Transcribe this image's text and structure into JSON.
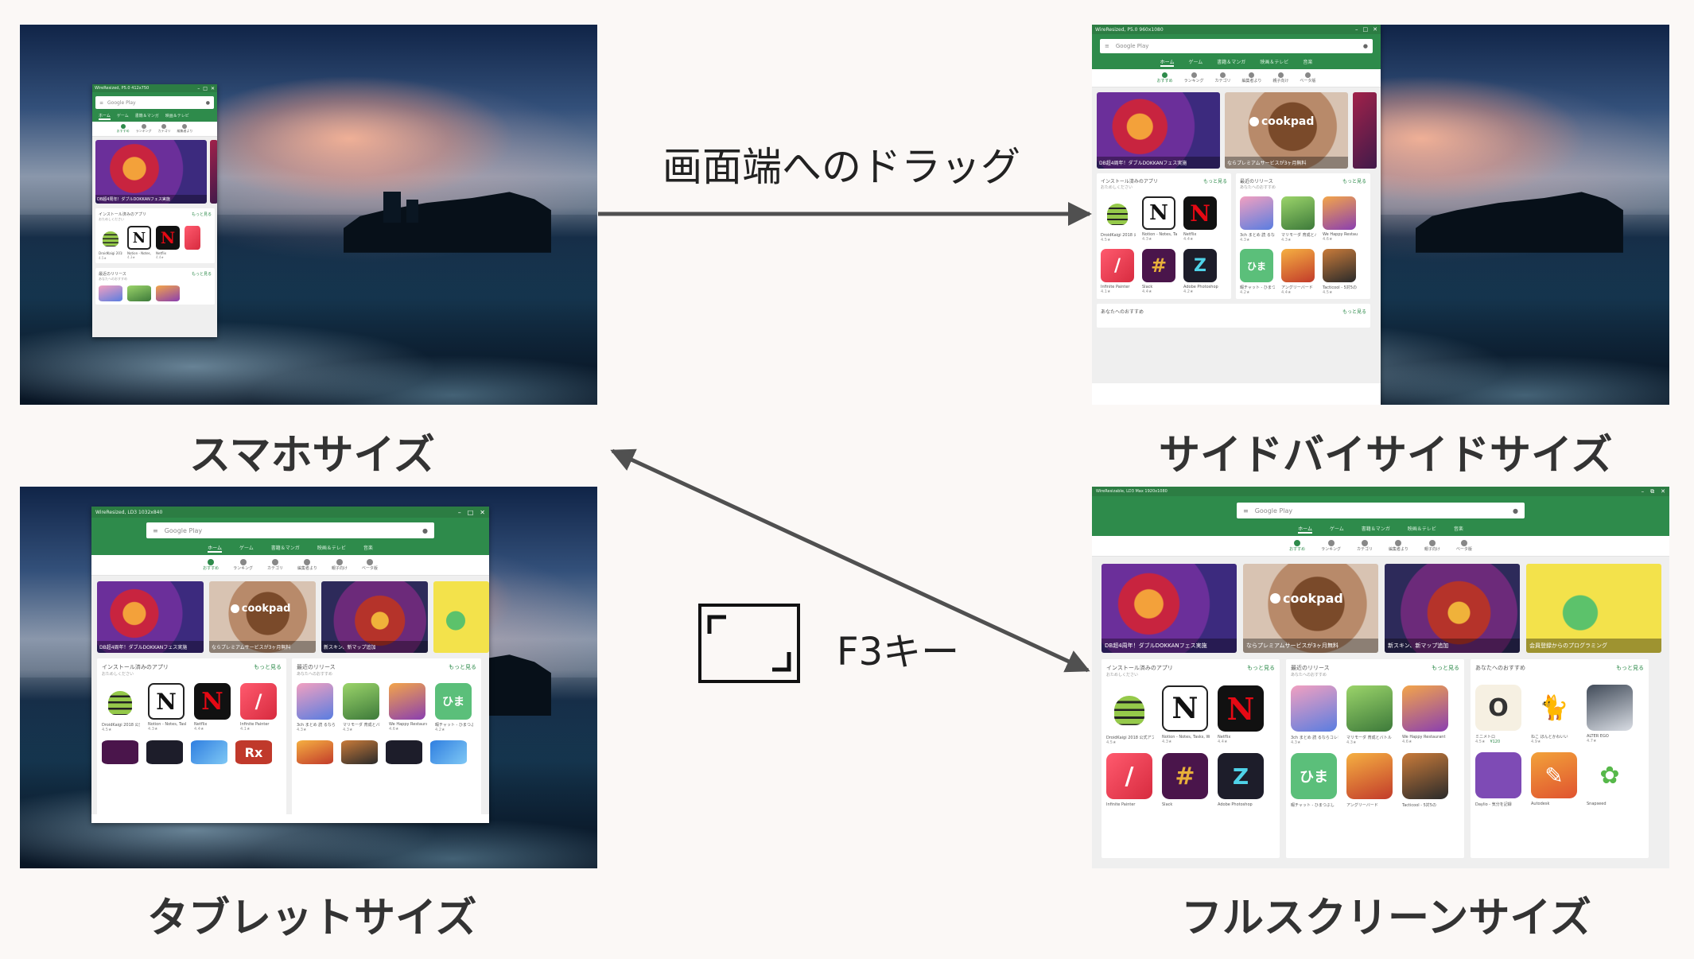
{
  "labels": {
    "phone": "スマホサイズ",
    "sidebyside": "サイドバイサイドサイズ",
    "tablet": "タブレットサイズ",
    "fullscreen": "フルスクリーンサイズ"
  },
  "arrows": {
    "drag_label": "画面端へのドラッグ",
    "key_label": "F3キー"
  },
  "windows": {
    "phone_title": "WireResized, P5.0 412x750",
    "side_title": "WireResized, P5.0 960x1080",
    "tablet_title": "WireResized, LD3 1032x840",
    "full_title": "WireResizable, LD3 Max 1920x1080"
  },
  "play": {
    "search_placeholder": "Google Play",
    "mic_icon": "mic-icon",
    "categories": [
      "ホーム",
      "ゲーム",
      "書籍＆マンガ",
      "映画＆テレビ",
      "音楽"
    ],
    "subnav": [
      "おすすめ",
      "ランキング",
      "カテゴリ",
      "編集者より",
      "親子向け",
      "ベータ版"
    ],
    "banners": [
      "DB超4周年！ダブルDOKKANフェス実施",
      "ならプレミアムサービスが3ヶ月無料",
      "新スキン、新マップ追加",
      "会員登録からのプログラミング"
    ],
    "cookpad_logo": "cookpad",
    "installed": {
      "title": "インストール済みのアプリ",
      "sub": "おためしください",
      "more": "もっと見る",
      "apps": [
        {
          "name": "DroidKaigi 2018 公式アプリ",
          "rating": "4.5★",
          "icon": "D"
        },
        {
          "name": "Notion - Notes, Tasks, Wikis",
          "rating": "4.3★",
          "icon": "N"
        },
        {
          "name": "Netflix",
          "rating": "4.4★",
          "icon": "N"
        },
        {
          "name": "Infinite Painter",
          "rating": "4.1★",
          "icon": "/"
        },
        {
          "name": "Slack",
          "rating": "4.4★",
          "icon": "#"
        },
        {
          "name": "Adobe Photoshop",
          "rating": "4.2★",
          "icon": "Z"
        }
      ]
    },
    "recent": {
      "title": "最近のリリース",
      "sub": "あなたへのおすすめ",
      "more": "もっと見る",
      "apps": [
        {
          "name": "3ch まとめ 読 るならコレ！",
          "rating": "4.3★",
          "icon": ""
        },
        {
          "name": "マリモーダ 育成とバトル",
          "rating": "4.3★",
          "icon": ""
        },
        {
          "name": "We Happy Restaurant",
          "rating": "4.6★",
          "icon": ""
        },
        {
          "name": "暇チャット - ひまつぶし",
          "rating": "4.2★",
          "icon": "ひま"
        },
        {
          "name": "アングリーバード",
          "rating": "4.4★",
          "icon": ""
        },
        {
          "name": "Tacticool - 5対5の",
          "rating": "4.5★",
          "icon": ""
        }
      ]
    },
    "recommend": {
      "title": "あなたへのおすすめ",
      "more": "もっと見る",
      "apps": [
        {
          "name": "ミニメトロ",
          "rating": "4.5★",
          "price": "¥120",
          "icon": "O"
        },
        {
          "name": "ねこ ほんとかわいい",
          "rating": "4.9★",
          "icon": "🐈"
        },
        {
          "name": "ALTER EGO",
          "rating": "4.7★",
          "icon": ""
        },
        {
          "name": "Daylio - 気分を記録",
          "rating": "",
          "icon": ""
        },
        {
          "name": "Autodesk",
          "rating": "",
          "icon": "✎"
        },
        {
          "name": "Snapseed",
          "rating": "",
          "icon": "✿"
        }
      ]
    }
  }
}
